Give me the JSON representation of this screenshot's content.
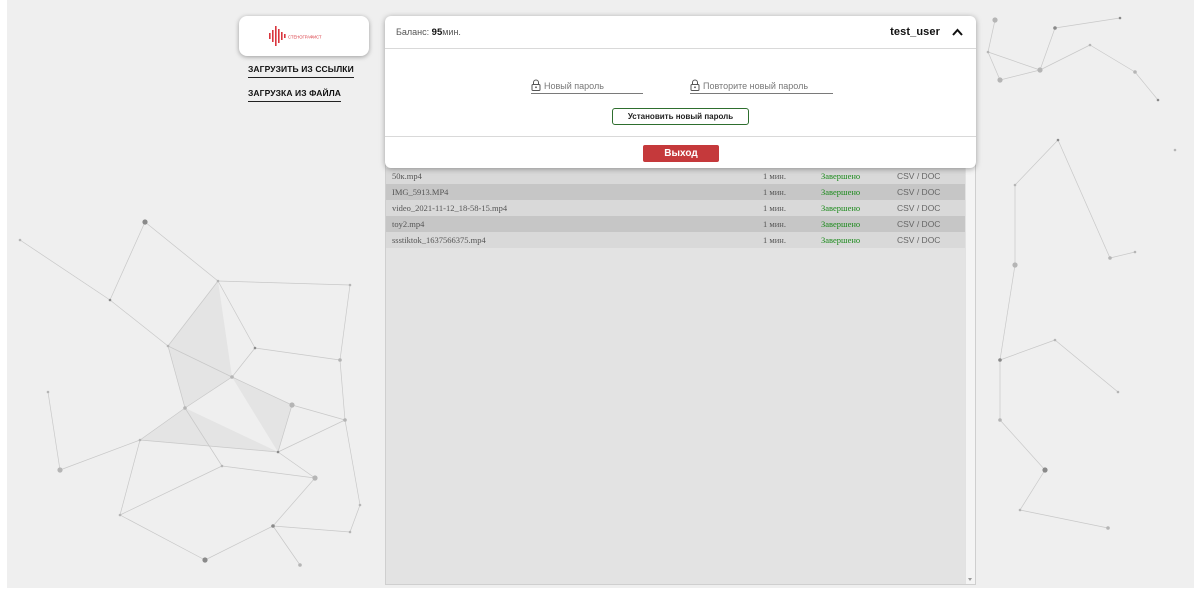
{
  "logo": {
    "icon": "soundwave-logo-icon",
    "text": "СТЕНОГРАФИСТ",
    "color": "#d9363e"
  },
  "nav": {
    "upload_link": "Загрузить из ссылки",
    "upload_file": "Загрузка из файла"
  },
  "account": {
    "balance_label": "Баланс:",
    "balance_value": "95",
    "balance_unit": "мин.",
    "username": "test_user",
    "toggle_icon": "chevron-up-icon"
  },
  "password_form": {
    "new_password_placeholder": "Новый пароль",
    "repeat_password_placeholder": "Повторите новый пароль",
    "lock_icon": "lock-icon",
    "submit_label": "Установить новый пароль"
  },
  "logout_label": "Выход",
  "files": [
    {
      "name": "50к.mp4",
      "duration": "1 мин.",
      "status": "Завершено",
      "export": "CSV / DOC"
    },
    {
      "name": "IMG_5913.MP4",
      "duration": "1 мин.",
      "status": "Завершено",
      "export": "CSV / DOC"
    },
    {
      "name": "video_2021-11-12_18-58-15.mp4",
      "duration": "1 мин.",
      "status": "Завершено",
      "export": "CSV / DOC"
    },
    {
      "name": "toy2.mp4",
      "duration": "1 мин.",
      "status": "Завершено",
      "export": "CSV / DOC"
    },
    {
      "name": "ssstiktok_1637566375.mp4",
      "duration": "1 мин.",
      "status": "Завершено",
      "export": "CSV / DOC"
    }
  ],
  "colors": {
    "logout": "#c5393b",
    "status_done": "#1b8a1b",
    "set_button_border": "#2e6e2e"
  }
}
